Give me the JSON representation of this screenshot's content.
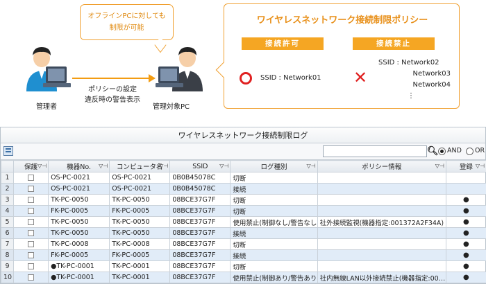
{
  "diagram": {
    "note_line1": "オフラインPCに対しても",
    "note_line2": "制限が可能",
    "policy_title": "ワイヤレスネットワーク接続制限ポリシー",
    "allow_label": "接続許可",
    "deny_label": "接続禁止",
    "allow_ssid": "SSID : Network01",
    "deny_ssids": [
      "SSID : Network02",
      "Network03",
      "Network04",
      "⋮"
    ],
    "arrow_line1": "ポリシーの設定",
    "arrow_line2": "違反時の警告表示",
    "admin_label": "管理者",
    "target_label": "管理対象PC",
    "colors": {
      "accent": "#f5a623",
      "mark": "#e02020"
    }
  },
  "log": {
    "title": "ワイヤレスネットワーク接続制限ログ",
    "search_value": "",
    "search_mode": {
      "and_label": "AND",
      "or_label": "OR",
      "selected": "AND"
    },
    "columns": [
      "",
      "保護",
      "機器No.",
      "コンピュータ名",
      "SSID",
      "ログ種別",
      "ポリシー情報",
      "登録"
    ],
    "filter_glyph": "▽⊣",
    "rows": [
      {
        "n": "1",
        "device": "OS-PC-0021",
        "computer": "OS-PC-0021",
        "ssid": "0B0B45078C",
        "type": "切断",
        "policy": "",
        "reg": ""
      },
      {
        "n": "2",
        "device": "OS-PC-0021",
        "computer": "OS-PC-0021",
        "ssid": "0B0B45078C",
        "type": "接続",
        "policy": "",
        "reg": ""
      },
      {
        "n": "3",
        "device": "TK-PC-0050",
        "computer": "TK-PC-0050",
        "ssid": "08BCE37G7F",
        "type": "切断",
        "policy": "",
        "reg": "●"
      },
      {
        "n": "4",
        "device": "FK-PC-0005",
        "computer": "FK-PC-0005",
        "ssid": "08BCE37G7F",
        "type": "切断",
        "policy": "",
        "reg": "●"
      },
      {
        "n": "5",
        "device": "TK-PC-0050",
        "computer": "TK-PC-0050",
        "ssid": "08BCE37G7F",
        "type": "使用禁止(制御なし/警告なし)",
        "policy": "社外接続監視(機器指定:001372A2F34A)",
        "reg": "●"
      },
      {
        "n": "6",
        "device": "TK-PC-0050",
        "computer": "TK-PC-0050",
        "ssid": "08BCE37G7F",
        "type": "接続",
        "policy": "",
        "reg": "●"
      },
      {
        "n": "7",
        "device": "TK-PC-0008",
        "computer": "TK-PC-0008",
        "ssid": "08BCE37G7F",
        "type": "切断",
        "policy": "",
        "reg": "●"
      },
      {
        "n": "8",
        "device": "FK-PC-0005",
        "computer": "FK-PC-0005",
        "ssid": "08BCE37G7F",
        "type": "接続",
        "policy": "",
        "reg": "●"
      },
      {
        "n": "9",
        "device": "●TK-PC-0001",
        "computer": "TK-PC-0001",
        "ssid": "08BCE37G7F",
        "type": "切断",
        "policy": "",
        "reg": "●"
      },
      {
        "n": "10",
        "device": "●TK-PC-0001",
        "computer": "TK-PC-0001",
        "ssid": "08BCE37G7F",
        "type": "使用禁止(制御あり/警告あり)",
        "policy": "社内無線LAN以外接続禁止(機器指定:00…",
        "reg": "●"
      }
    ]
  }
}
